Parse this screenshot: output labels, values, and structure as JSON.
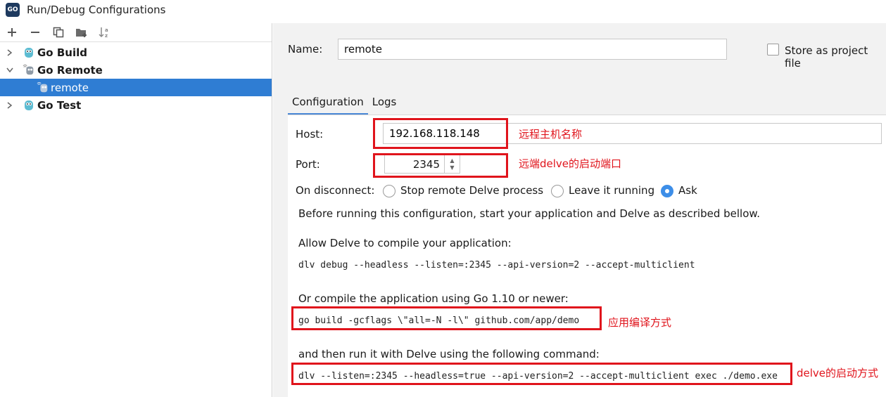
{
  "window": {
    "icon_text": "GO",
    "title": "Run/Debug Configurations"
  },
  "toolbar": {
    "icons": [
      "add-icon",
      "remove-icon",
      "copy-icon",
      "new-folder-icon",
      "sort-alphabetically-icon"
    ],
    "add_label": "+",
    "remove_label": "−"
  },
  "tree": {
    "items": [
      {
        "label": "Go Build",
        "expanded": false
      },
      {
        "label": "Go Remote",
        "expanded": true
      },
      {
        "label": "remote",
        "selected": true
      },
      {
        "label": "Go Test",
        "expanded": false
      }
    ]
  },
  "form": {
    "name_label": "Name:",
    "name_value": "remote",
    "store_label": "Store as project file",
    "tabs": [
      "Configuration",
      "Logs"
    ],
    "host_label": "Host:",
    "host_value": "192.168.118.148",
    "port_label": "Port:",
    "port_value": "2345",
    "disconnect_label": "On disconnect:",
    "disconnect_options": [
      "Stop remote Delve process",
      "Leave it running",
      "Ask"
    ],
    "disconnect_selected": "Ask",
    "intro_text": "Before running this configuration, start your application and Delve as described bellow.",
    "allow_text": "Allow Delve to compile your application:",
    "debug_cmd": "dlv debug --headless --listen=:2345 --api-version=2 --accept-multiclient",
    "compile_text": "Or compile the application using Go 1.10 or newer:",
    "build_cmd": "go build -gcflags \\\"all=-N -l\\\" github.com/app/demo",
    "run_text": "and then run it with Delve using the following command:",
    "exec_cmd": "dlv --listen=:2345 --headless=true --api-version=2 --accept-multiclient exec ./demo.exe"
  },
  "annotations": {
    "host": "远程主机名称",
    "port": "远端delve的启动端口",
    "build": "应用编译方式",
    "exec": "delve的启动方式",
    "color": "#e0141c"
  },
  "colors": {
    "selection": "#2f7dd3",
    "radio_checked": "#3d8ee8",
    "tab_underline": "#4a88d6"
  }
}
